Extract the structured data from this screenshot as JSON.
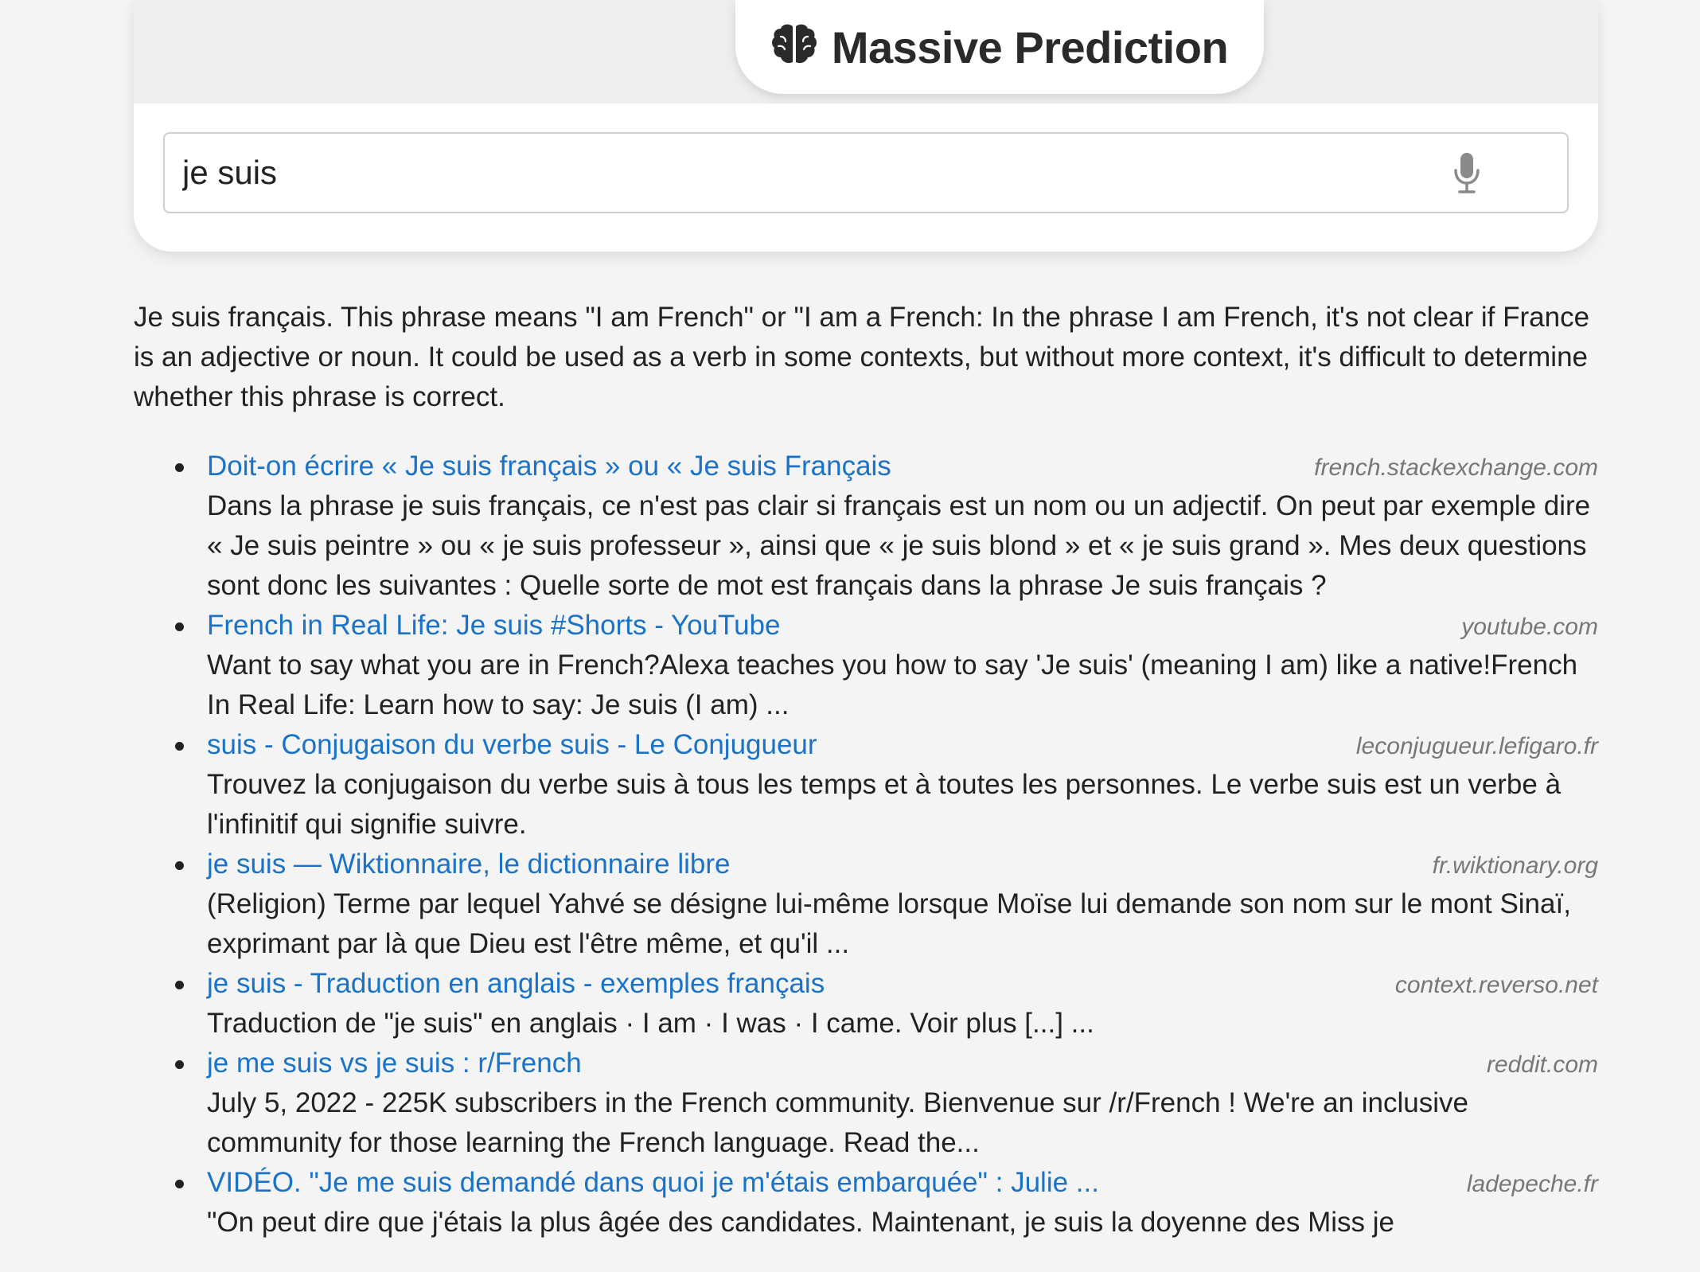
{
  "header": {
    "title": "Massive Prediction",
    "icon": "brain-icon"
  },
  "search": {
    "value": "je suis",
    "mic_icon": "microphone-icon"
  },
  "answer": "Je suis français. This phrase means \"I am French\" or \"I am a French: In the phrase I am French, it's not clear if France is an adjective or noun. It could be used as a verb in some contexts, but without more context, it's difficult to determine whether this phrase is correct.",
  "results": [
    {
      "title": "Doit-on écrire « Je suis français » ou « Je suis Français",
      "domain": "french.stackexchange.com",
      "snippet": "Dans la phrase je suis français, ce n'est pas clair si français est un nom ou un adjectif. On peut par exemple dire « Je suis peintre » ou « je suis professeur », ainsi que « je suis blond » et « je suis grand ». Mes deux questions sont donc les suivantes : Quelle sorte de mot est français dans la phrase Je suis français ?"
    },
    {
      "title": "French in Real Life: Je suis #Shorts - YouTube",
      "domain": "youtube.com",
      "snippet": "Want to say what you are in French?Alexa teaches you how to say 'Je suis' (meaning I am) like a native!French In Real Life: Learn how to say: Je suis (I am) ..."
    },
    {
      "title": "suis - Conjugaison du verbe suis - Le Conjugueur",
      "domain": "leconjugueur.lefigaro.fr",
      "snippet": "Trouvez la conjugaison du verbe suis à tous les temps et à toutes les personnes. Le verbe suis est un verbe à l'infinitif qui signifie suivre."
    },
    {
      "title": "je suis — Wiktionnaire, le dictionnaire libre",
      "domain": "fr.wiktionary.org",
      "snippet": "(Religion) Terme par lequel Yahvé se désigne lui-même lorsque Moïse lui demande son nom sur le mont Sinaï, exprimant par là que Dieu est l'être même, et qu'il ..."
    },
    {
      "title": "je suis - Traduction en anglais - exemples français",
      "domain": "context.reverso.net",
      "snippet": "Traduction de \"je suis\" en anglais · I am · I was · I came. Voir plus [...] ..."
    },
    {
      "title": "je me suis vs je suis : r/French",
      "domain": "reddit.com",
      "snippet": "July 5, 2022 - 225K subscribers in the French community. Bienvenue sur /r/French ! We're an inclusive community for those learning the French language. Read the..."
    },
    {
      "title": "VIDÉO. \"Je me suis demandé dans quoi je m'étais embarquée\" : Julie ...",
      "domain": "ladepeche.fr",
      "snippet": "\"On peut dire que j'étais la plus âgée des candidates. Maintenant, je suis la doyenne des Miss je"
    }
  ],
  "colors": {
    "link": "#1a73c8",
    "domain": "#777777",
    "background": "#f4f4f4",
    "text": "#222222"
  }
}
